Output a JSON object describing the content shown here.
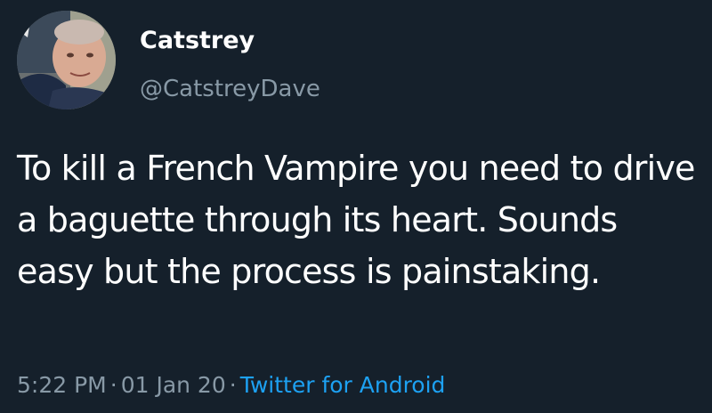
{
  "user": {
    "display_name": "Catstrey",
    "handle": "@CatstreyDave"
  },
  "tweet": {
    "text": "To kill a French Vampire you need to drive a baguette through its heart. Sounds easy but the process is painstaking.",
    "time": "5:22 PM",
    "date": "01 Jan 20",
    "source": "Twitter for Android",
    "separator": "·"
  },
  "colors": {
    "background": "#15202b",
    "primary_text": "#ffffff",
    "secondary_text": "#8899a6",
    "link": "#1da1f2"
  }
}
